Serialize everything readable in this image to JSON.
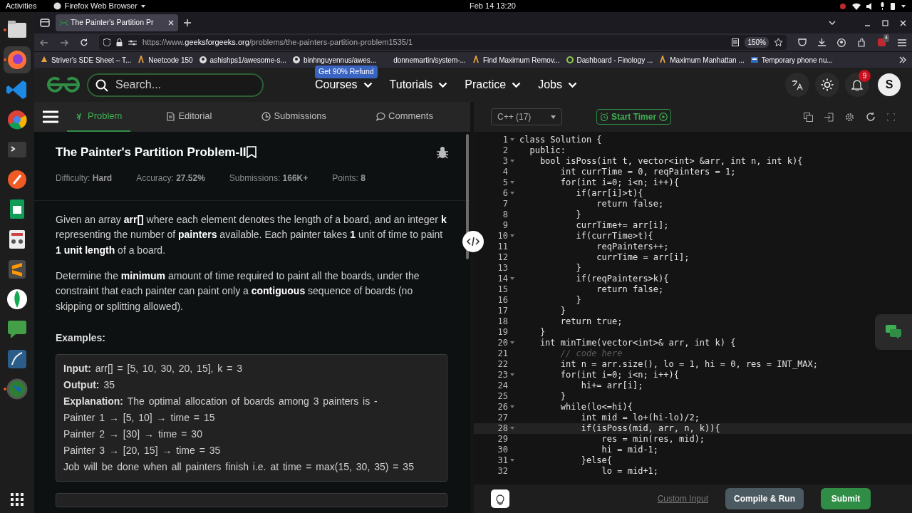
{
  "os_bar": {
    "activities": "Activities",
    "app": "Firefox Web Browser",
    "clock": "Feb 14  13:20"
  },
  "dock": [
    {
      "kind": "files",
      "running": true,
      "active": false
    },
    {
      "kind": "firefox",
      "running": true,
      "active": true
    },
    {
      "kind": "vscode",
      "running": false,
      "active": false
    },
    {
      "kind": "chrome",
      "running": false,
      "active": false
    },
    {
      "kind": "terminal",
      "running": false,
      "active": false
    },
    {
      "kind": "postman",
      "running": false,
      "active": false
    },
    {
      "kind": "sheets",
      "running": false,
      "active": false
    },
    {
      "kind": "viewer",
      "running": false,
      "active": false
    },
    {
      "kind": "sublime",
      "running": false,
      "active": false
    },
    {
      "kind": "mongo",
      "running": false,
      "active": false
    },
    {
      "kind": "chat",
      "running": false,
      "active": false
    },
    {
      "kind": "workbench",
      "running": false,
      "active": false
    },
    {
      "kind": "globe",
      "running": true,
      "active": false
    }
  ],
  "browser": {
    "tab_title": "The Painter's Partition Pr",
    "url_scheme": "https://www.",
    "url_domain": "geeksforgeeks.org",
    "url_path": "/problems/the-painters-partition-problem1535/1",
    "zoom": "150%",
    "extension_badge": "4",
    "bookmarks": [
      {
        "label": "Striver's SDE Sheet – T...",
        "kind": "striver"
      },
      {
        "label": "Neetcode 150",
        "kind": "neetcode"
      },
      {
        "label": "ashishps1/awesome-s...",
        "kind": "github"
      },
      {
        "label": "binhnguyennus/awes...",
        "kind": "github"
      },
      {
        "label": "donnemartin/system-...",
        "kind": "none"
      },
      {
        "label": "Find Maximum Remov...",
        "kind": "neetcode"
      },
      {
        "label": "Dashboard - Finology ...",
        "kind": "ring"
      },
      {
        "label": "Maximum Manhattan ...",
        "kind": "neetcode"
      },
      {
        "label": "Temporary phone nu...",
        "kind": "phone"
      }
    ]
  },
  "site": {
    "search_placeholder": "Search...",
    "promo": "Get 90% Refund",
    "nav": [
      "Courses",
      "Tutorials",
      "Practice",
      "Jobs"
    ],
    "notifications": "9",
    "avatar": "S"
  },
  "problem_tabs": [
    {
      "label": "Problem",
      "kind": "problem",
      "selected": true
    },
    {
      "label": "Editorial",
      "kind": "editorial",
      "selected": false
    },
    {
      "label": "Submissions",
      "kind": "submissions",
      "selected": false
    },
    {
      "label": "Comments",
      "kind": "comments",
      "selected": false
    }
  ],
  "problem": {
    "title": "The Painter's Partition Problem-II",
    "stats": [
      {
        "label": "Difficulty:",
        "value": "Hard"
      },
      {
        "label": "Accuracy:",
        "value": "27.52%"
      },
      {
        "label": "Submissions:",
        "value": "166K+"
      },
      {
        "label": "Points:",
        "value": "8"
      }
    ],
    "paragraphs": [
      "Given an array **arr[]** where each element denotes the length of a board, and an integer **k** representing the number of **painters** available. Each painter takes **1** unit of time to paint **1 unit length** of a board.",
      "Determine the **minimum** amount of time required to paint all the boards, under the constraint that each painter can paint only a **contiguous** sequence of boards (no skipping or splitting allowed)."
    ],
    "examples_heading": "Examples:",
    "example_lines": [
      "**Input:** arr[] = [5, 10, 30, 20, 15], k = 3",
      "**Output:** 35",
      "**Explanation:** The optimal allocation of boards among 3 painters is -",
      "Painter 1 → [5, 10] → time = 15",
      "Painter 2 → [30] → time = 30",
      "Painter 3 → [20, 15] → time = 35",
      "Job will be done when all painters finish i.e. at time = max(15, 30, 35) = 35"
    ]
  },
  "editor": {
    "language": "C++ (17)",
    "timer": "Start Timer",
    "custom_input": "Custom Input",
    "run": "Compile & Run",
    "submit": "Submit",
    "lines": [
      {
        "num": "1",
        "text": "class Solution {",
        "fold": true,
        "kind": "code",
        "active": false
      },
      {
        "num": "2",
        "text": "  public:",
        "fold": false,
        "kind": "code",
        "active": false
      },
      {
        "num": "3",
        "text": "    bool isPoss(int t, vector<int> &arr, int n, int k){",
        "fold": true,
        "kind": "code",
        "active": false
      },
      {
        "num": "4",
        "text": "        int currTime = 0, reqPainters = 1;",
        "fold": false,
        "kind": "code",
        "active": false
      },
      {
        "num": "5",
        "text": "        for(int i=0; i<n; i++){",
        "fold": true,
        "kind": "code",
        "active": false
      },
      {
        "num": "6",
        "text": "           if(arr[i]>t){",
        "fold": true,
        "kind": "code",
        "active": false
      },
      {
        "num": "7",
        "text": "               return false;",
        "fold": false,
        "kind": "code",
        "active": false
      },
      {
        "num": "8",
        "text": "           }",
        "fold": false,
        "kind": "code",
        "active": false
      },
      {
        "num": "9",
        "text": "           currTime+= arr[i];",
        "fold": false,
        "kind": "code",
        "active": false
      },
      {
        "num": "10",
        "text": "           if(currTime>t){",
        "fold": true,
        "kind": "code",
        "active": false
      },
      {
        "num": "11",
        "text": "               reqPainters++;",
        "fold": false,
        "kind": "code",
        "active": false
      },
      {
        "num": "12",
        "text": "               currTime = arr[i];",
        "fold": false,
        "kind": "code",
        "active": false
      },
      {
        "num": "13",
        "text": "           }",
        "fold": false,
        "kind": "code",
        "active": false
      },
      {
        "num": "14",
        "text": "           if(reqPainters>k){",
        "fold": true,
        "kind": "code",
        "active": false
      },
      {
        "num": "15",
        "text": "               return false;",
        "fold": false,
        "kind": "code",
        "active": false
      },
      {
        "num": "16",
        "text": "           }",
        "fold": false,
        "kind": "code",
        "active": false
      },
      {
        "num": "17",
        "text": "        }",
        "fold": false,
        "kind": "code",
        "active": false
      },
      {
        "num": "18",
        "text": "        return true;",
        "fold": false,
        "kind": "code",
        "active": false
      },
      {
        "num": "19",
        "text": "    }",
        "fold": false,
        "kind": "code",
        "active": false
      },
      {
        "num": "20",
        "text": "    int minTime(vector<int>& arr, int k) {",
        "fold": true,
        "kind": "code",
        "active": false
      },
      {
        "num": "21",
        "text": "        // code here",
        "fold": false,
        "kind": "comment",
        "active": false
      },
      {
        "num": "22",
        "text": "        int n = arr.size(), lo = 1, hi = 0, res = INT_MAX;",
        "fold": false,
        "kind": "code",
        "active": false
      },
      {
        "num": "23",
        "text": "        for(int i=0; i<n; i++){",
        "fold": true,
        "kind": "code",
        "active": false
      },
      {
        "num": "24",
        "text": "            hi+= arr[i];",
        "fold": false,
        "kind": "code",
        "active": false
      },
      {
        "num": "25",
        "text": "        }",
        "fold": false,
        "kind": "code",
        "active": false
      },
      {
        "num": "26",
        "text": "        while(lo<=hi){",
        "fold": true,
        "kind": "code",
        "active": false
      },
      {
        "num": "27",
        "text": "            int mid = lo+(hi-lo)/2;",
        "fold": false,
        "kind": "code",
        "active": false
      },
      {
        "num": "28",
        "text": "            if(isPoss(mid, arr, n, k)){",
        "fold": true,
        "kind": "code",
        "active": true
      },
      {
        "num": "29",
        "text": "                res = min(res, mid);",
        "fold": false,
        "kind": "code",
        "active": false
      },
      {
        "num": "30",
        "text": "                hi = mid-1;",
        "fold": false,
        "kind": "code",
        "active": false
      },
      {
        "num": "31",
        "text": "            }else{",
        "fold": true,
        "kind": "code",
        "active": false
      },
      {
        "num": "32",
        "text": "                lo = mid+1;",
        "fold": false,
        "kind": "code",
        "active": false
      }
    ]
  }
}
